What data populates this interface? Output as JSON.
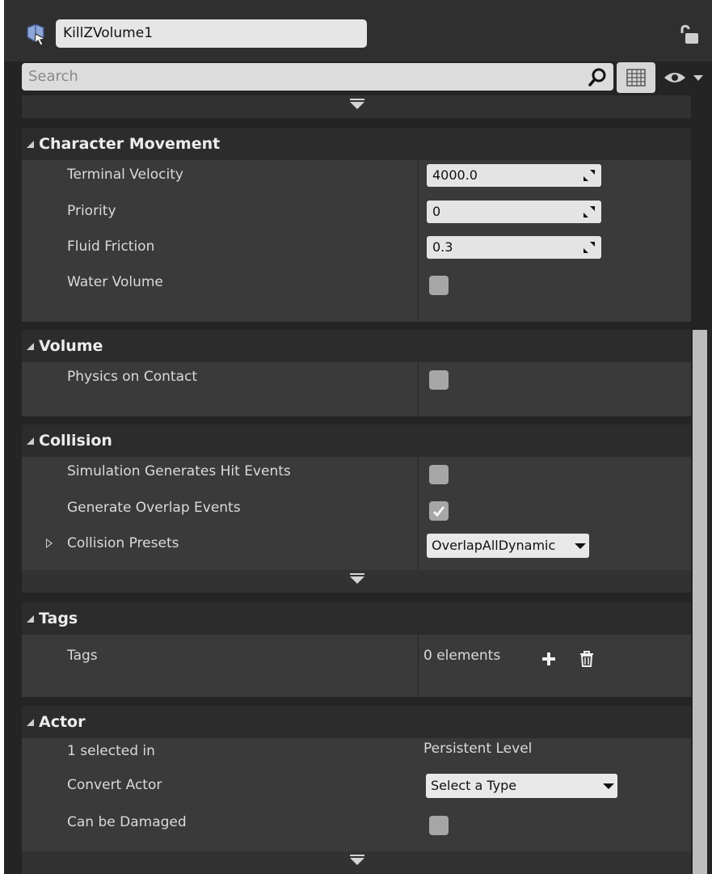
{
  "header": {
    "actor_name": "KillZVolume1",
    "actor_icon": "actor-class-icon",
    "lock_icon": "lock-icon"
  },
  "toolbar": {
    "search_placeholder": "Search",
    "search_icon": "search-icon",
    "grid_icon": "property-matrix-icon",
    "view_icon": "eye-icon"
  },
  "categories": {
    "character_movement": {
      "title": "Character Movement",
      "terminal_velocity": {
        "label": "Terminal Velocity",
        "value": "4000.0"
      },
      "priority": {
        "label": "Priority",
        "value": "0"
      },
      "fluid_friction": {
        "label": "Fluid Friction",
        "value": "0.3"
      },
      "water_volume": {
        "label": "Water Volume",
        "checked": false
      }
    },
    "volume": {
      "title": "Volume",
      "physics_on_contact": {
        "label": "Physics on Contact",
        "checked": false
      }
    },
    "collision": {
      "title": "Collision",
      "sim_hit_events": {
        "label": "Simulation Generates Hit Events",
        "checked": false
      },
      "overlap_events": {
        "label": "Generate Overlap Events",
        "checked": true
      },
      "collision_presets": {
        "label": "Collision Presets",
        "value": "OverlapAllDynamic"
      }
    },
    "tags": {
      "title": "Tags",
      "tags": {
        "label": "Tags",
        "value": "0 elements"
      }
    },
    "actor": {
      "title": "Actor",
      "selected_in": {
        "label": "1 selected in",
        "value": "Persistent Level"
      },
      "convert_actor": {
        "label": "Convert Actor",
        "value": "Select a Type"
      },
      "can_be_damaged": {
        "label": "Can be Damaged",
        "checked": false
      }
    }
  },
  "colors": {
    "panel_bg": "#242424",
    "category_bg": "#3a3a3a",
    "category_header": "#2c2c2c",
    "text": "#dadada",
    "field_bg": "#e4e4e4"
  }
}
